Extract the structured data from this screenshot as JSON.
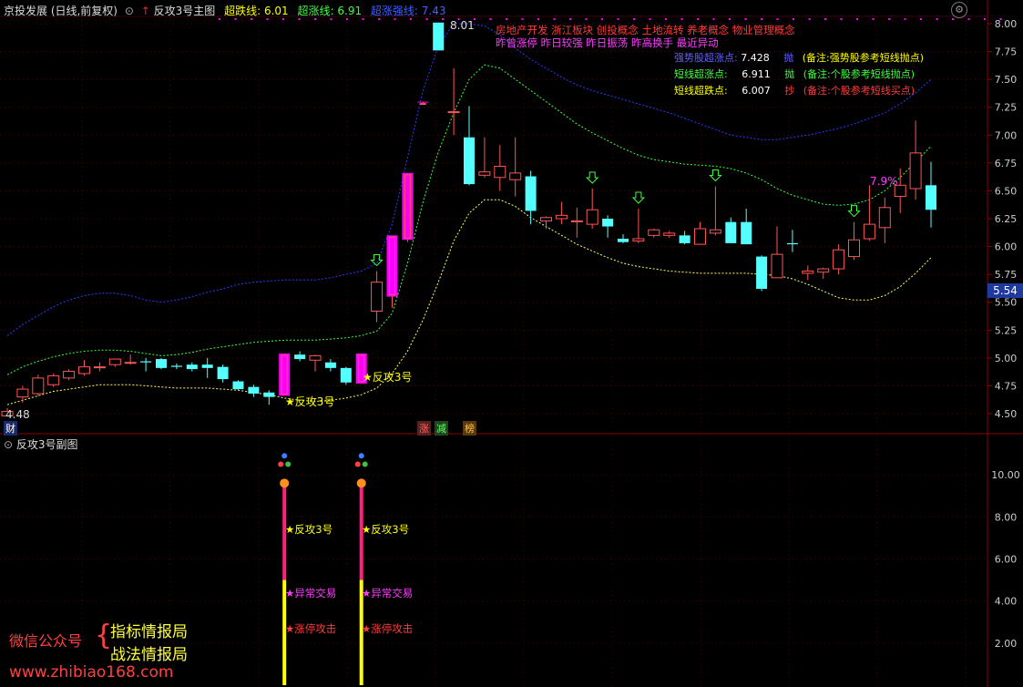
{
  "colors": {
    "up": "#ff5555",
    "down": "#54ffff",
    "magenta": "#ff00ff",
    "upper_band": "#2a3cff",
    "mid_band": "#3cff3c",
    "lower_band": "#ffff60",
    "label_yellow": "#ffff00",
    "label_red": "#ff3c3c",
    "label_blue": "#6060ff",
    "label_green": "#3cff3c"
  },
  "header": {
    "stock_title": "京投发展 (日线,前复权)",
    "indicator_name": "反攻3号主图",
    "line1_label": "超跌线:",
    "line1_value": "6.01",
    "line2_label": "超涨线:",
    "line2_value": "6.91",
    "line3_label": "超涨强线:",
    "line3_value": "7.43"
  },
  "concepts": {
    "line1": "房地产开发 浙江板块  创投概念  土地流转  养老概念  物业管理概念",
    "line2": "昨曾涨停  昨日较强  昨日振荡  昨高换手  最近异动"
  },
  "notes": [
    {
      "label": "强势股超涨点:",
      "value": "7.428",
      "action": "抛",
      "remark": "(备注:强势股参考短线抛点)",
      "color": "label_blue"
    },
    {
      "label": "短线超涨点:",
      "value": "6.911",
      "action": "抛",
      "remark": "(备注:个股参考短线抛点)",
      "color": "label_green"
    },
    {
      "label": "短线超跌点:",
      "value": "6.007",
      "action": "抄",
      "remark": "(备注:个股参考短线买点)",
      "color": "label_red"
    }
  ],
  "main_axis": {
    "ticks": [
      "8.00",
      "7.75",
      "7.50",
      "7.25",
      "7.00",
      "6.75",
      "6.50",
      "6.25",
      "6.00",
      "5.75",
      "5.50",
      "5.25",
      "5.00",
      "4.75",
      "4.50"
    ],
    "current_price": "5.54"
  },
  "annotations": {
    "high_label": "8.01",
    "low_label": "4.48",
    "pct_label": "7.9%",
    "signal_1": "★反攻3号",
    "signal_2": "★反攻3号",
    "bottom_tag_cai": "财",
    "bottom_tag_zhang": "涨",
    "bottom_tag_jian": "减",
    "bottom_tag_bang": "榜"
  },
  "sub_panel": {
    "title": "反攻3号副图",
    "axis_ticks": [
      "10.00",
      "8.00",
      "6.00",
      "4.00",
      "2.00"
    ],
    "signal_a": "★反攻3号",
    "signal_b": "★异常交易",
    "signal_c": "★涨停攻击"
  },
  "watermark": {
    "wechat": "微信公众号",
    "line1": "指标情报局",
    "line2": "战法情报局",
    "site": "www.zhibiao168.com"
  },
  "chart_data": {
    "type": "candlestick",
    "y_range": [
      4.4,
      8.05
    ],
    "candles": [
      {
        "o": 4.48,
        "h": 4.55,
        "l": 4.48,
        "c": 4.52
      },
      {
        "o": 4.65,
        "h": 4.75,
        "l": 4.6,
        "c": 4.72
      },
      {
        "o": 4.68,
        "h": 4.85,
        "l": 4.66,
        "c": 4.82
      },
      {
        "o": 4.76,
        "h": 4.86,
        "l": 4.74,
        "c": 4.84
      },
      {
        "o": 4.82,
        "h": 4.9,
        "l": 4.8,
        "c": 4.88
      },
      {
        "o": 4.86,
        "h": 4.98,
        "l": 4.84,
        "c": 4.92
      },
      {
        "o": 4.92,
        "h": 4.96,
        "l": 4.88,
        "c": 4.92
      },
      {
        "o": 4.94,
        "h": 4.99,
        "l": 4.92,
        "c": 4.99
      },
      {
        "o": 4.96,
        "h": 5.03,
        "l": 4.94,
        "c": 4.96
      },
      {
        "o": 4.97,
        "h": 5.0,
        "l": 4.88,
        "c": 4.96
      },
      {
        "o": 4.99,
        "h": 5.0,
        "l": 4.9,
        "c": 4.91
      },
      {
        "o": 4.93,
        "h": 4.95,
        "l": 4.9,
        "c": 4.92
      },
      {
        "o": 4.94,
        "h": 4.96,
        "l": 4.88,
        "c": 4.9
      },
      {
        "o": 4.94,
        "h": 5.0,
        "l": 4.82,
        "c": 4.91
      },
      {
        "o": 4.92,
        "h": 4.94,
        "l": 4.78,
        "c": 4.81
      },
      {
        "o": 4.79,
        "h": 4.8,
        "l": 4.71,
        "c": 4.72
      },
      {
        "o": 4.74,
        "h": 4.76,
        "l": 4.65,
        "c": 4.68
      },
      {
        "o": 4.69,
        "h": 4.71,
        "l": 4.58,
        "c": 4.65
      },
      {
        "o": 4.66,
        "h": 5.04,
        "l": 4.66,
        "c": 5.04
      },
      {
        "o": 5.03,
        "h": 5.06,
        "l": 4.97,
        "c": 4.99
      },
      {
        "o": 4.98,
        "h": 5.03,
        "l": 4.88,
        "c": 5.02
      },
      {
        "o": 4.96,
        "h": 4.99,
        "l": 4.88,
        "c": 4.91
      },
      {
        "o": 4.91,
        "h": 4.92,
        "l": 4.76,
        "c": 4.78
      },
      {
        "o": 4.77,
        "h": 5.04,
        "l": 4.77,
        "c": 5.04
      },
      {
        "o": 5.42,
        "h": 5.78,
        "l": 5.32,
        "c": 5.68
      },
      {
        "o": 5.55,
        "h": 6.1,
        "l": 5.45,
        "c": 6.1
      },
      {
        "o": 6.06,
        "h": 6.66,
        "l": 6.04,
        "c": 6.66
      },
      {
        "o": 7.3,
        "h": 7.3,
        "l": 7.28,
        "c": 7.3
      },
      {
        "o": 8.01,
        "h": 8.01,
        "l": 7.78,
        "c": 7.76
      },
      {
        "o": 7.21,
        "h": 7.6,
        "l": 7.0,
        "c": 7.21
      },
      {
        "o": 6.98,
        "h": 7.26,
        "l": 6.55,
        "c": 6.56
      },
      {
        "o": 6.64,
        "h": 6.98,
        "l": 6.62,
        "c": 6.67
      },
      {
        "o": 6.62,
        "h": 6.91,
        "l": 6.5,
        "c": 6.72
      },
      {
        "o": 6.6,
        "h": 6.98,
        "l": 6.45,
        "c": 6.66
      },
      {
        "o": 6.63,
        "h": 6.68,
        "l": 6.2,
        "c": 6.32
      },
      {
        "o": 6.23,
        "h": 6.27,
        "l": 6.16,
        "c": 6.26
      },
      {
        "o": 6.25,
        "h": 6.4,
        "l": 6.2,
        "c": 6.28
      },
      {
        "o": 6.23,
        "h": 6.35,
        "l": 6.08,
        "c": 6.23
      },
      {
        "o": 6.2,
        "h": 6.52,
        "l": 6.16,
        "c": 6.33
      },
      {
        "o": 6.25,
        "h": 6.28,
        "l": 6.08,
        "c": 6.18
      },
      {
        "o": 6.07,
        "h": 6.11,
        "l": 6.03,
        "c": 6.04
      },
      {
        "o": 6.05,
        "h": 6.34,
        "l": 6.03,
        "c": 6.07
      },
      {
        "o": 6.1,
        "h": 6.16,
        "l": 6.08,
        "c": 6.15
      },
      {
        "o": 6.1,
        "h": 6.14,
        "l": 6.08,
        "c": 6.12
      },
      {
        "o": 6.1,
        "h": 6.14,
        "l": 6.02,
        "c": 6.03
      },
      {
        "o": 6.02,
        "h": 6.22,
        "l": 6.02,
        "c": 6.16
      },
      {
        "o": 6.12,
        "h": 6.54,
        "l": 6.1,
        "c": 6.15
      },
      {
        "o": 6.22,
        "h": 6.26,
        "l": 6.05,
        "c": 6.03
      },
      {
        "o": 6.22,
        "h": 6.34,
        "l": 6.03,
        "c": 6.02
      },
      {
        "o": 5.91,
        "h": 5.92,
        "l": 5.6,
        "c": 5.62
      },
      {
        "o": 5.72,
        "h": 6.18,
        "l": 5.72,
        "c": 5.93
      },
      {
        "o": 6.03,
        "h": 6.15,
        "l": 5.95,
        "c": 6.02
      },
      {
        "o": 5.76,
        "h": 5.83,
        "l": 5.7,
        "c": 5.78
      },
      {
        "o": 5.77,
        "h": 5.81,
        "l": 5.71,
        "c": 5.8
      },
      {
        "o": 5.8,
        "h": 6.02,
        "l": 5.75,
        "c": 5.97
      },
      {
        "o": 5.91,
        "h": 6.22,
        "l": 5.88,
        "c": 6.06
      },
      {
        "o": 6.07,
        "h": 6.55,
        "l": 6.05,
        "c": 6.2
      },
      {
        "o": 6.17,
        "h": 6.44,
        "l": 6.03,
        "c": 6.35
      },
      {
        "o": 6.45,
        "h": 6.7,
        "l": 6.3,
        "c": 6.55
      },
      {
        "o": 6.52,
        "h": 7.13,
        "l": 6.42,
        "c": 6.84
      },
      {
        "o": 6.55,
        "h": 6.76,
        "l": 6.17,
        "c": 6.33
      }
    ],
    "magenta_bars": [
      18,
      23,
      25,
      26,
      27
    ],
    "signal_candles": [
      18,
      23
    ],
    "arrow_candles": [
      24,
      38,
      41,
      46,
      55
    ],
    "upper_band": [
      5.2,
      5.3,
      5.38,
      5.46,
      5.52,
      5.56,
      5.58,
      5.58,
      5.56,
      5.52,
      5.5,
      5.52,
      5.55,
      5.59,
      5.62,
      5.66,
      5.68,
      5.69,
      5.7,
      5.7,
      5.7,
      5.72,
      5.75,
      5.78,
      5.85,
      6.2,
      6.8,
      7.4,
      7.8,
      8.0,
      8.0,
      7.98,
      7.9,
      7.78,
      7.68,
      7.6,
      7.52,
      7.45,
      7.4,
      7.36,
      7.32,
      7.28,
      7.24,
      7.2,
      7.15,
      7.1,
      7.05,
      7.0,
      6.98,
      6.96,
      6.96,
      6.98,
      7.0,
      7.03,
      7.06,
      7.1,
      7.15,
      7.2,
      7.28,
      7.38,
      7.5
    ],
    "mid_band": [
      4.85,
      4.92,
      4.97,
      5.01,
      5.04,
      5.06,
      5.07,
      5.07,
      5.06,
      5.04,
      5.02,
      5.03,
      5.05,
      5.08,
      5.1,
      5.12,
      5.14,
      5.15,
      5.16,
      5.16,
      5.16,
      5.17,
      5.18,
      5.2,
      5.24,
      5.4,
      5.85,
      6.4,
      6.85,
      7.2,
      7.5,
      7.63,
      7.6,
      7.5,
      7.4,
      7.3,
      7.2,
      7.1,
      7.02,
      6.95,
      6.88,
      6.82,
      6.78,
      6.76,
      6.74,
      6.73,
      6.72,
      6.7,
      6.66,
      6.6,
      6.52,
      6.46,
      6.42,
      6.38,
      6.37,
      6.38,
      6.42,
      6.5,
      6.62,
      6.76,
      6.9
    ],
    "lower_band": [
      4.58,
      4.62,
      4.66,
      4.7,
      4.72,
      4.74,
      4.76,
      4.76,
      4.76,
      4.75,
      4.74,
      4.73,
      4.73,
      4.73,
      4.72,
      4.71,
      4.69,
      4.67,
      4.64,
      4.62,
      4.61,
      4.62,
      4.64,
      4.67,
      4.73,
      4.86,
      5.06,
      5.34,
      5.68,
      6.05,
      6.3,
      6.42,
      6.42,
      6.36,
      6.26,
      6.18,
      6.1,
      6.02,
      5.96,
      5.9,
      5.85,
      5.82,
      5.8,
      5.78,
      5.77,
      5.76,
      5.76,
      5.76,
      5.76,
      5.75,
      5.74,
      5.71,
      5.66,
      5.6,
      5.54,
      5.52,
      5.52,
      5.56,
      5.64,
      5.76,
      5.9
    ]
  }
}
